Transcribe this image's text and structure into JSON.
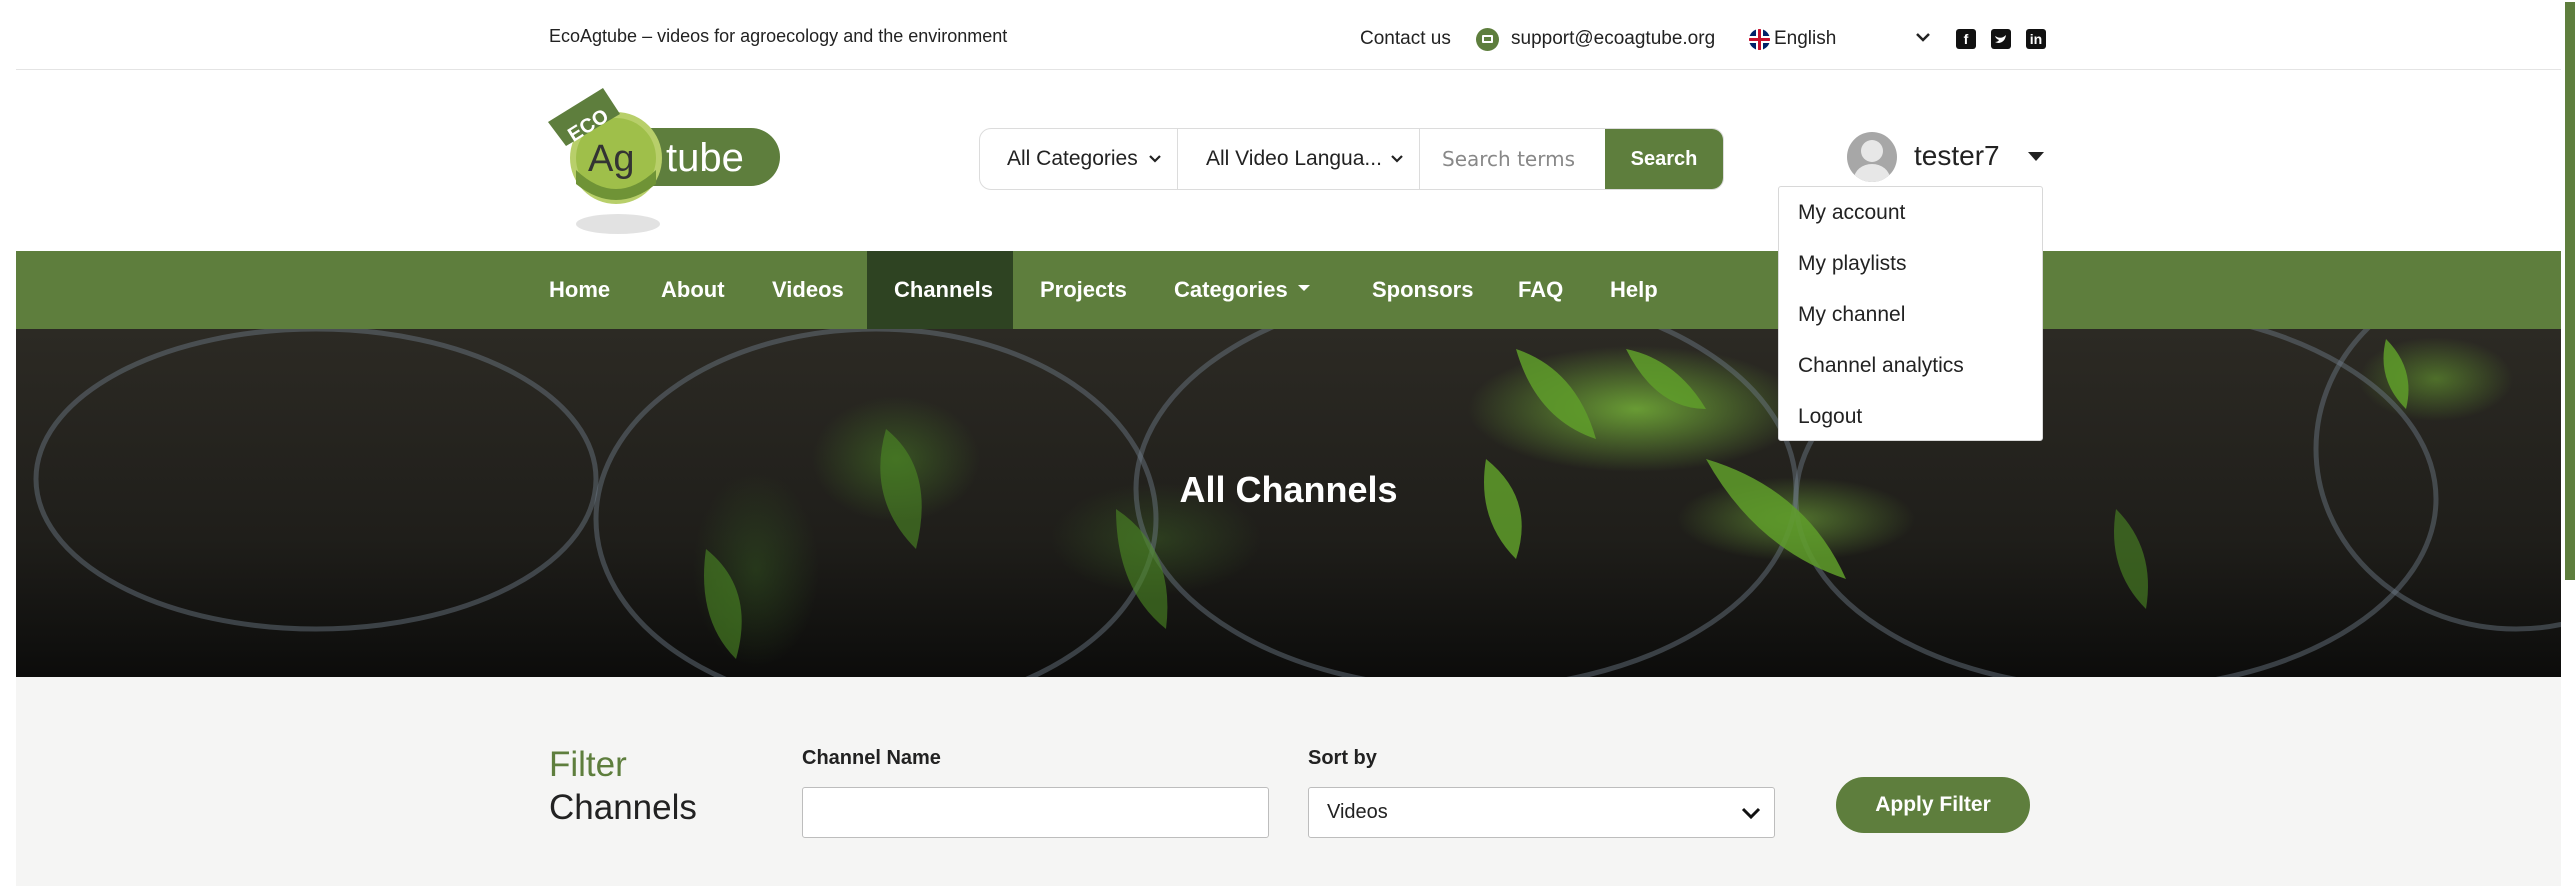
{
  "topbar": {
    "tagline": "EcoAgtube – videos for agroecology and the environment",
    "contact_label": "Contact us",
    "email": "support@ecoagtube.org",
    "language": "English",
    "social": [
      "facebook-icon",
      "twitter-icon",
      "linkedin-icon"
    ]
  },
  "logo": {
    "eco": "ECO",
    "ag": "Ag",
    "tube": "tube"
  },
  "search": {
    "category": "All Categories",
    "video_language": "All Video Langua...",
    "placeholder": "Search terms",
    "button": "Search"
  },
  "user": {
    "name": "tester7",
    "menu": [
      "My account",
      "My playlists",
      "My channel",
      "Channel analytics",
      "Logout"
    ]
  },
  "nav": {
    "items": [
      "Home",
      "About",
      "Videos",
      "Channels",
      "Projects",
      "Categories",
      "Sponsors",
      "FAQ",
      "Help"
    ],
    "active": "Channels"
  },
  "hero": {
    "title": "All Channels"
  },
  "filter": {
    "title_green": "Filter",
    "title_dark": "Channels",
    "channel_name_label": "Channel Name",
    "channel_name_value": "",
    "sort_label": "Sort by",
    "sort_value": "Videos",
    "apply": "Apply Filter"
  },
  "colors": {
    "brand_green": "#5e7e3d",
    "nav_active": "#2e4322"
  }
}
